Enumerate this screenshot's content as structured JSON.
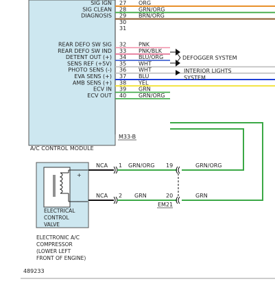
{
  "module": {
    "name": "A/C CONTROL MODULE",
    "connector": "M33-B",
    "pins": [
      {
        "label": "SIG IGN",
        "pin": "27",
        "wire": "ORG",
        "color": "#e8902a"
      },
      {
        "label": "SIG CLEAN",
        "pin": "28",
        "wire": "GRN/ORG",
        "color": "#4caf50"
      },
      {
        "label": "DIAGNOSIS",
        "pin": "29",
        "wire": "BRN/ORG",
        "color": "#8b5a2b"
      },
      {
        "label": "",
        "pin": "30",
        "wire": "",
        "color": ""
      },
      {
        "label": "",
        "pin": "31",
        "wire": "",
        "color": ""
      },
      {
        "label": "REAR DEFO SW SIG",
        "pin": "32",
        "wire": "PNK",
        "color": "#f08aa6"
      },
      {
        "label": "REAR DEFO SW IND",
        "pin": "33",
        "wire": "PNK/BLK",
        "color": "#e46a8f"
      },
      {
        "label": "DETENT OUT (+)",
        "pin": "34",
        "wire": "BLU/ORG",
        "color": "#3a5bd0"
      },
      {
        "label": "SENS REF (+5V)",
        "pin": "35",
        "wire": "WHT",
        "color": "#bdbdbd"
      },
      {
        "label": "PHOTO SENS (-)",
        "pin": "36",
        "wire": "WHT",
        "color": "#bdbdbd"
      },
      {
        "label": "EVA SENS (+)",
        "pin": "37",
        "wire": "BLU",
        "color": "#1f3fd6"
      },
      {
        "label": "AMB SENS (+)",
        "pin": "38",
        "wire": "YEL",
        "color": "#f2e23a"
      },
      {
        "label": "ECV IN",
        "pin": "39",
        "wire": "GRN",
        "color": "#3aa845"
      },
      {
        "label": "ECV OUT",
        "pin": "40",
        "wire": "GRN/ORG",
        "color": "#3aa845"
      }
    ]
  },
  "destinations": {
    "defogger": "DEFOGGER SYSTEM",
    "interior_line1": "INTERIOR LIGHTS",
    "interior_line2": "SYSTEM"
  },
  "compressor": {
    "valve_line1": "ELECTRICAL",
    "valve_line2": "CONTROL",
    "valve_line3": "VALVE",
    "name_line1": "ELECTRONIC A/C",
    "name_line2": "COMPRESSOR",
    "name_line3": "(LOWER LEFT",
    "name_line4": "FRONT OF ENGINE)",
    "pin_top": {
      "nca": "NCA",
      "pin": "1",
      "wire": "GRN/ORG"
    },
    "pin_bottom": {
      "nca": "NCA",
      "pin": "2",
      "wire": "GRN"
    }
  },
  "junction": {
    "name": "EM21",
    "top": {
      "pin": "19",
      "wire": "GRN/ORG"
    },
    "bottom": {
      "pin": "20",
      "wire": "GRN"
    }
  },
  "figure_id": "489233"
}
